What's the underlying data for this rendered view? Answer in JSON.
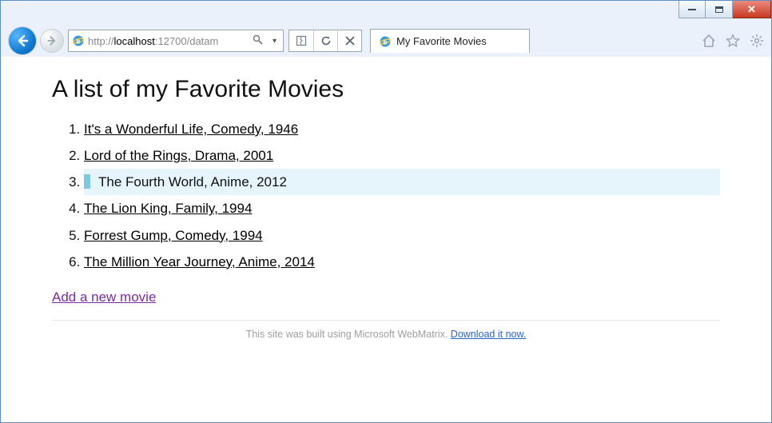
{
  "browser": {
    "url_light_prefix": "http://",
    "url_dark_host": "localhost",
    "url_light_suffix": ":12700/datam",
    "tab_title": "My Favorite Movies"
  },
  "page": {
    "heading": "A list of my Favorite Movies",
    "movies": [
      {
        "title": "It's a Wonderful Life",
        "genre": "Comedy",
        "year": "1946",
        "selected": false
      },
      {
        "title": "Lord of the Rings",
        "genre": "Drama",
        "year": "2001",
        "selected": false
      },
      {
        "title": "The Fourth World",
        "genre": "Anime",
        "year": "2012",
        "selected": true
      },
      {
        "title": "The Lion King",
        "genre": "Family",
        "year": "1994",
        "selected": false
      },
      {
        "title": "Forrest Gump",
        "genre": "Comedy",
        "year": "1994",
        "selected": false
      },
      {
        "title": "The Million Year Journey",
        "genre": "Anime",
        "year": "2014",
        "selected": false
      }
    ],
    "add_link": "Add a new movie",
    "footer_text": "This site was built using Microsoft WebMatrix. ",
    "footer_link": "Download it now."
  }
}
